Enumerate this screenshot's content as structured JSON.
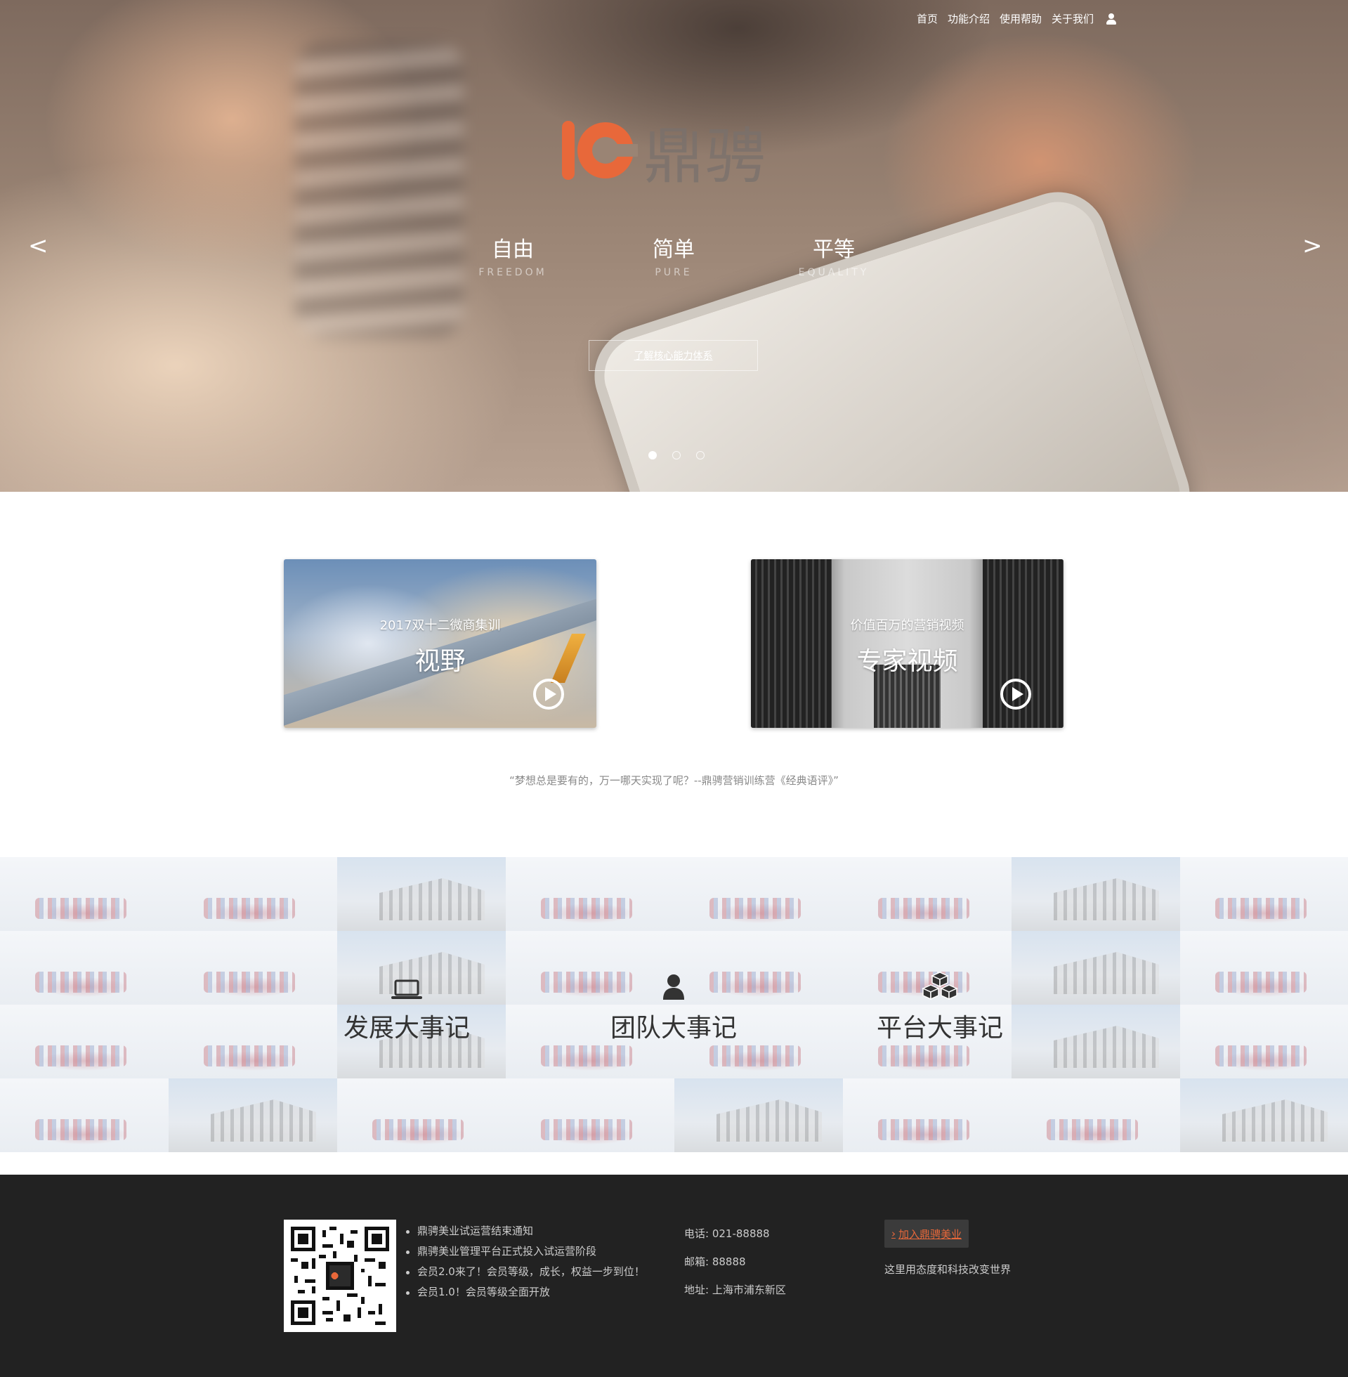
{
  "nav": {
    "items": [
      "首页",
      "功能介绍",
      "使用帮助",
      "关于我们"
    ],
    "user_icon": "user-icon"
  },
  "hero": {
    "logo_text": "鼎骋",
    "brand_color": "#e8683a",
    "pillars": [
      {
        "cn": "自由",
        "en": "FREEDOM"
      },
      {
        "cn": "简单",
        "en": "PURE"
      },
      {
        "cn": "平等",
        "en": "EQUALITY"
      }
    ],
    "button_label": "了解核心能力体系",
    "prev_arrow": "<",
    "next_arrow": ">",
    "slides_total": 3,
    "slide_active": 1
  },
  "cards": [
    {
      "title": "2017双十二微商集训",
      "headline": "视野",
      "icon": "play-icon"
    },
    {
      "title": "价值百万的营销视频",
      "headline": "专家视频",
      "icon": "play-icon"
    }
  ],
  "quote": "“梦想总是要有的，万一哪天实现了呢？--鼎骋营销训练营《经典语评》”",
  "milestones": [
    {
      "label": "发展大事记",
      "icon": "laptop-icon"
    },
    {
      "label": "团队大事记",
      "icon": "user-icon"
    },
    {
      "label": "平台大事记",
      "icon": "cubes-icon"
    }
  ],
  "footer": {
    "news": [
      "鼎骋美业试运营结束通知",
      "鼎骋美业管理平台正式投入试运营阶段",
      "会员2.0来了！会员等级，成长，权益一步到位！",
      "会员1.0！会员等级全面开放"
    ],
    "phone": "电话: 021-88888",
    "email": "邮箱: 88888",
    "address": "地址: 上海市浦东新区",
    "join_label": "加入鼎骋美业",
    "slogan": "这里用态度和科技改变世界",
    "background": "#222222"
  }
}
